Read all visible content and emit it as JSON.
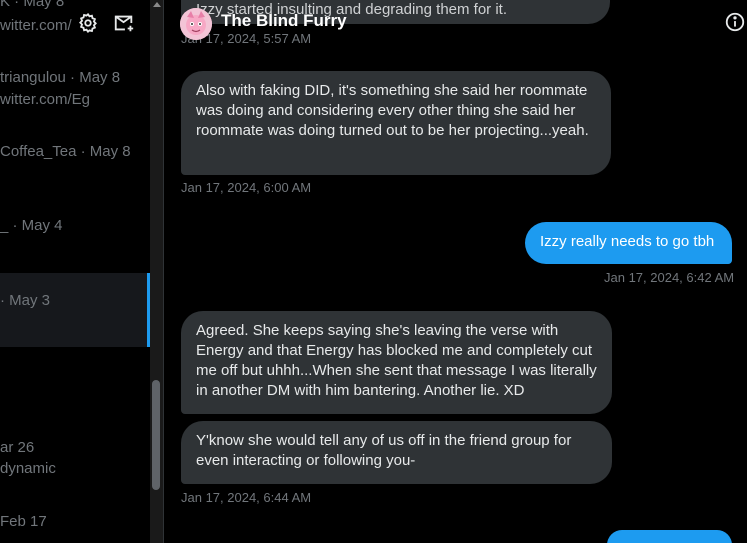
{
  "left_panel": {
    "conversations": [
      {
        "line1": "K · May 8",
        "line2": "witter.com/"
      },
      {
        "line1": "triangulou · May 8",
        "line2": "witter.com/Eg"
      },
      {
        "line1": "Coffea_Tea · May 8",
        "line2": ""
      },
      {
        "line1": "_ · May 4",
        "line2": ""
      },
      {
        "line1": "· May 3",
        "line2": ""
      },
      {
        "line1": "ar 26",
        "line2": "dynamic"
      },
      {
        "line1": "Feb 17",
        "line2": ""
      }
    ]
  },
  "chat": {
    "contact_name": "The Blind Furry",
    "top_partial_text": "Izzy started insulting and degrading them for it.",
    "messages": [
      {
        "type": "timestamp",
        "text": "Jan 17, 2024, 5:57 AM"
      },
      {
        "type": "in",
        "text": "Also with faking DID, it's something she said her roommate was doing and considering every other thing she said her roommate was doing turned out to be her projecting...yeah."
      },
      {
        "type": "timestamp",
        "text": "Jan 17, 2024, 6:00 AM"
      },
      {
        "type": "out",
        "text": "Izzy really needs to go tbh"
      },
      {
        "type": "timestamp",
        "text": "Jan 17, 2024, 6:42 AM"
      },
      {
        "type": "in",
        "text": "Agreed. She keeps saying she's leaving the verse with Energy and that Energy has blocked me and completely cut me off but uhhh...When she sent that message I was literally in another DM with him bantering. Another lie. XD"
      },
      {
        "type": "in",
        "text": "Y'know she would tell any of us off in the friend group for even interacting or following you-"
      },
      {
        "type": "timestamp",
        "text": "Jan 17, 2024, 6:44 AM"
      }
    ]
  },
  "icons": {
    "settings": "gear-icon",
    "new_message": "new-message-icon",
    "info": "info-icon"
  },
  "colors": {
    "accent": "#1d9bf0",
    "incoming_bubble": "#2f3336",
    "background": "#000000",
    "muted_text": "#71767b"
  }
}
